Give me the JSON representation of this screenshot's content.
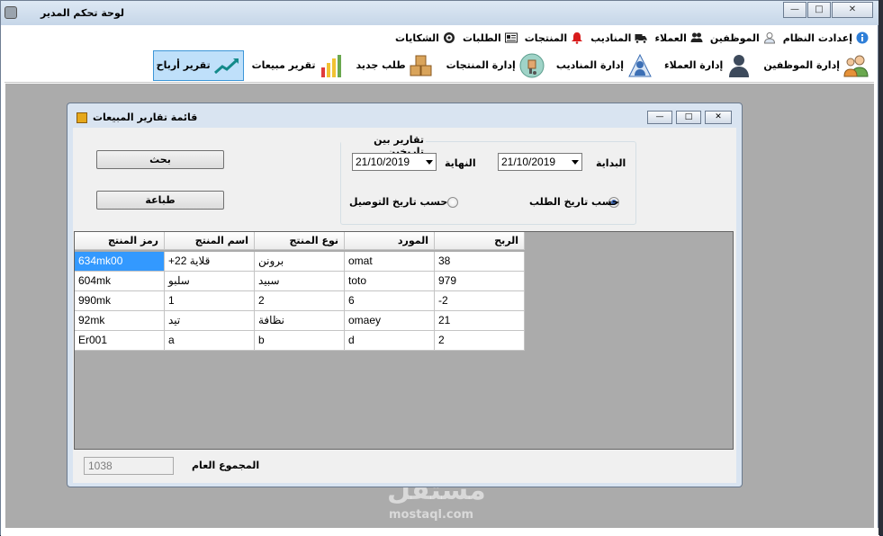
{
  "app": {
    "title": "لوحة تحكم المدير"
  },
  "menu": [
    {
      "label": "إعدادت النظام",
      "icon": "info-icon"
    },
    {
      "label": "الموظفين",
      "icon": "person-icon"
    },
    {
      "label": "العملاء",
      "icon": "people-icon"
    },
    {
      "label": "المناديب",
      "icon": "truck-icon"
    },
    {
      "label": "المنتجات",
      "icon": "bell-icon"
    },
    {
      "label": "الطلبات",
      "icon": "card-icon"
    },
    {
      "label": "الشكايات",
      "icon": "gear-icon"
    }
  ],
  "toolbar": [
    {
      "label": "إدارة الموظفين",
      "icon": "employees-icon"
    },
    {
      "label": "إدارة العملاء",
      "icon": "customers-icon"
    },
    {
      "label": "إدارة المناديب",
      "icon": "delivery-icon"
    },
    {
      "label": "إدارة المنتجات",
      "icon": "boxes-icon"
    },
    {
      "label": "طلب جديد",
      "icon": "new-order-icon"
    },
    {
      "label": "تقرير مبيعات",
      "icon": "bar-chart-icon"
    },
    {
      "label": "تقرير أرباح",
      "icon": "trend-icon",
      "selected": true
    }
  ],
  "child": {
    "title": "قائمة تقارير المبيعات",
    "search_label": "بحث",
    "print_label": "طباعة",
    "group_title": "تقارير بين تاريخين",
    "start_label": "البداية",
    "end_label": "النهاية",
    "start_date": "21/10/2019",
    "end_date": "21/10/2019",
    "radio_order": "حسب تاريخ الطلب",
    "radio_delivery": "حسب تاريخ التوصيل",
    "total_label": "المجموع العام",
    "total_value": "1038"
  },
  "grid": {
    "headers": [
      "رمز المنتج",
      "اسم المنتج",
      "نوع المنتج",
      "المورد",
      "الربح"
    ],
    "rows": [
      [
        "634mk00",
        "+قلاية 22",
        "برونن",
        "omat",
        "38"
      ],
      [
        "604mk",
        "سلبو",
        "سبيد",
        "toto",
        "979"
      ],
      [
        "990mk",
        "1",
        "2",
        "6",
        "-2"
      ],
      [
        "92mk",
        "تيد",
        "نظافة",
        "omaey",
        "21"
      ],
      [
        "Er001",
        "a",
        "b",
        "d",
        "2"
      ]
    ]
  },
  "watermark": {
    "text": "مستقل",
    "sub": "mostaql.com"
  },
  "colors": {
    "selection": "#3399ff",
    "toolbar_selected": "#bfe0fa",
    "mdi_background": "#ababab"
  }
}
